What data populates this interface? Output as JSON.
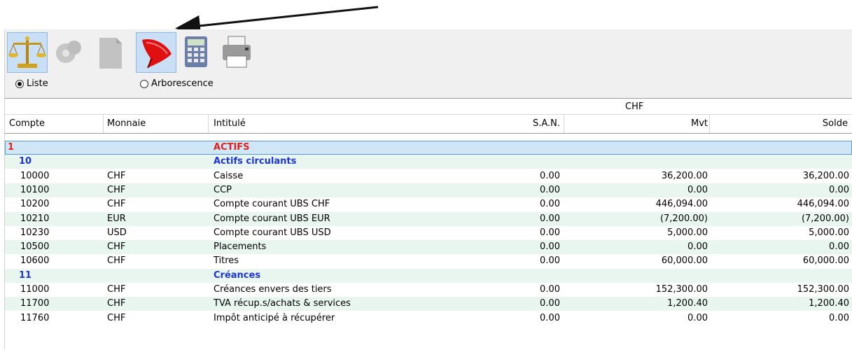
{
  "toolbar": {
    "icons": [
      "balance-scale-icon",
      "gear-icon",
      "document-icon",
      "funnel-filter-icon",
      "calculator-icon",
      "printer-icon"
    ],
    "active": [
      "balance-scale-icon",
      "funnel-filter-icon"
    ]
  },
  "view_mode": {
    "list_label": "Liste",
    "tree_label": "Arborescence",
    "selected": "Liste"
  },
  "table": {
    "currency_group": "CHF",
    "columns": [
      "Compte",
      "Monnaie",
      "Intitulé",
      "S.A.N.",
      "Mvt",
      "Solde"
    ],
    "rows": [
      {
        "compte": "1",
        "monnaie": "",
        "intitule": "ACTIFS",
        "san": "",
        "mvt": "",
        "solde": "",
        "kind": "top"
      },
      {
        "compte": "10",
        "monnaie": "",
        "intitule": "Actifs circulants",
        "san": "",
        "mvt": "",
        "solde": "",
        "kind": "group"
      },
      {
        "compte": "10000",
        "monnaie": "CHF",
        "intitule": "Caisse",
        "san": "0.00",
        "mvt": "36,200.00",
        "solde": "36,200.00",
        "kind": "item"
      },
      {
        "compte": "10100",
        "monnaie": "CHF",
        "intitule": "CCP",
        "san": "0.00",
        "mvt": "0.00",
        "solde": "0.00",
        "kind": "item"
      },
      {
        "compte": "10200",
        "monnaie": "CHF",
        "intitule": "Compte courant UBS CHF",
        "san": "0.00",
        "mvt": "446,094.00",
        "solde": "446,094.00",
        "kind": "item"
      },
      {
        "compte": "10210",
        "monnaie": "EUR",
        "intitule": "Compte courant UBS EUR",
        "san": "0.00",
        "mvt": "(7,200.00)",
        "solde": "(7,200.00)",
        "kind": "item"
      },
      {
        "compte": "10230",
        "monnaie": "USD",
        "intitule": "Compte courant UBS USD",
        "san": "0.00",
        "mvt": "5,000.00",
        "solde": "5,000.00",
        "kind": "item"
      },
      {
        "compte": "10500",
        "monnaie": "CHF",
        "intitule": "Placements",
        "san": "0.00",
        "mvt": "0.00",
        "solde": "0.00",
        "kind": "item"
      },
      {
        "compte": "10600",
        "monnaie": "CHF",
        "intitule": "Titres",
        "san": "0.00",
        "mvt": "60,000.00",
        "solde": "60,000.00",
        "kind": "item"
      },
      {
        "compte": "11",
        "monnaie": "",
        "intitule": "Créances",
        "san": "",
        "mvt": "",
        "solde": "",
        "kind": "group"
      },
      {
        "compte": "11000",
        "monnaie": "CHF",
        "intitule": "Créances envers des tiers",
        "san": "0.00",
        "mvt": "152,300.00",
        "solde": "152,300.00",
        "kind": "item"
      },
      {
        "compte": "11700",
        "monnaie": "CHF",
        "intitule": "TVA récup.s/achats & services",
        "san": "0.00",
        "mvt": "1,200.40",
        "solde": "1,200.40",
        "kind": "item"
      },
      {
        "compte": "11760",
        "monnaie": "CHF",
        "intitule": "Impôt anticipé à récupérer",
        "san": "0.00",
        "mvt": "0.00",
        "solde": "0.00",
        "kind": "item"
      }
    ]
  },
  "colors": {
    "top_level": "#e0201b",
    "group_level": "#1c35d8",
    "alt_row": "#e9f6ef",
    "selected_row": "#cfe6f7"
  }
}
